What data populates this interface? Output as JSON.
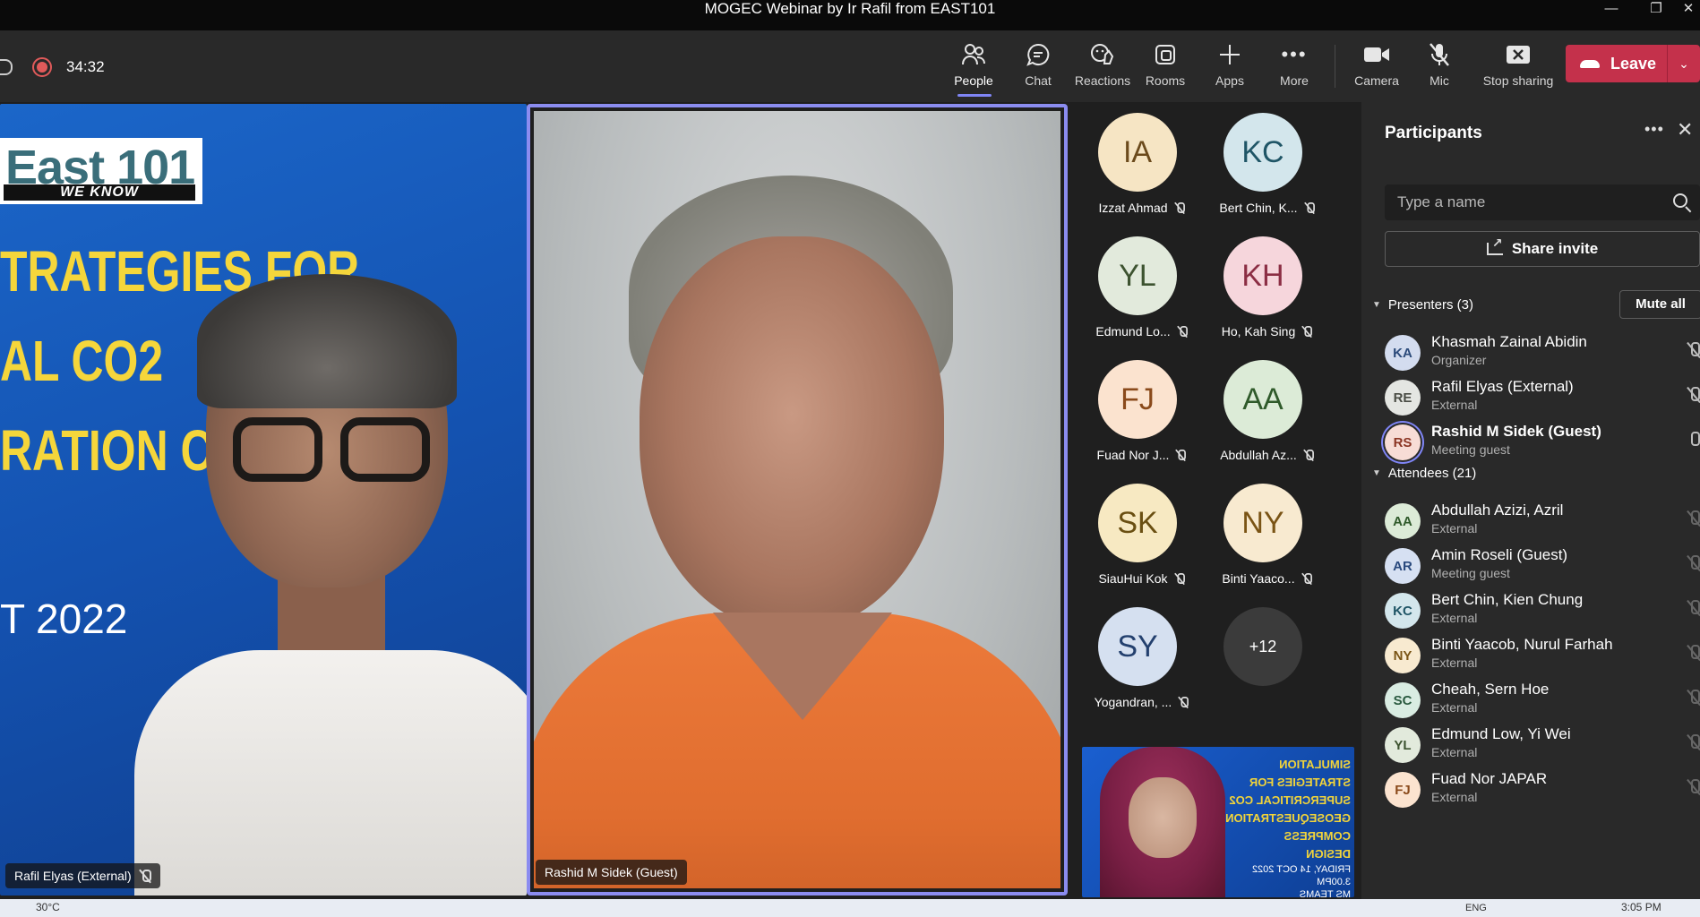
{
  "window": {
    "title": "MOGEC Webinar by Ir Rafil from EAST101"
  },
  "call": {
    "elapsed": "34:32"
  },
  "toolbar": {
    "people": "People",
    "chat": "Chat",
    "reactions": "Reactions",
    "rooms": "Rooms",
    "apps": "Apps",
    "more": "More",
    "camera": "Camera",
    "mic": "Mic",
    "stop_sharing": "Stop sharing",
    "leave": "Leave"
  },
  "stage": {
    "tile1": {
      "logo_main": "East 101",
      "logo_sub": "WE KNOW",
      "slide_lines": [
        "TRATEGIES FOR",
        "AL CO2",
        "RATION C"
      ],
      "slide_date": "T 2022",
      "name": "Rafil Elyas (External)"
    },
    "tile2": {
      "name": "Rashid M Sidek (Guest)"
    },
    "gallery": [
      {
        "initials": "IA",
        "name": "Izzat Ahmad",
        "bg": "#f6e5c4",
        "fg": "#6b4a1c"
      },
      {
        "initials": "KC",
        "name": "Bert Chin, K...",
        "bg": "#d3e6ec",
        "fg": "#1f5566"
      },
      {
        "initials": "YL",
        "name": "Edmund Lo...",
        "bg": "#e2eadc",
        "fg": "#3d5330"
      },
      {
        "initials": "KH",
        "name": "Ho, Kah Sing",
        "bg": "#f6d6dc",
        "fg": "#8b2e44"
      },
      {
        "initials": "FJ",
        "name": "Fuad Nor J...",
        "bg": "#fbe3cf",
        "fg": "#8a4a1b"
      },
      {
        "initials": "AA",
        "name": "Abdullah Az...",
        "bg": "#dcebd7",
        "fg": "#2f5a2a"
      },
      {
        "initials": "SK",
        "name": "SiauHui Kok",
        "bg": "#f7e9c2",
        "fg": "#6a4f12"
      },
      {
        "initials": "NY",
        "name": "Binti Yaaco...",
        "bg": "#f8ead0",
        "fg": "#7a5415"
      },
      {
        "initials": "SY",
        "name": "Yogandran, ...",
        "bg": "#d5e0f0",
        "fg": "#23406e"
      }
    ],
    "overflow_count": "+12",
    "tile3": {
      "slide_lines": [
        "SIMULATION STRATEGIES FOR",
        "SUPERCRITICAL CO2",
        "GEOSEQUESTRATION COMPRESS",
        "DESIGN"
      ],
      "slide_small": [
        "FRIDAY, 14 OCT 2022",
        "3.00PM",
        "MS TEAMS"
      ]
    }
  },
  "panel": {
    "title": "Participants",
    "search_placeholder": "Type a name",
    "share_invite": "Share invite",
    "presenters_label": "Presenters (3)",
    "mute_all": "Mute all",
    "presenters": [
      {
        "initials": "KA",
        "name": "Khasmah Zainal Abidin",
        "role": "Organizer",
        "bg": "#d3dcef",
        "fg": "#2b4a7a"
      },
      {
        "initials": "RE",
        "name": "Rafil Elyas (External)",
        "role": "External",
        "bg": "#e4e6e2",
        "fg": "#4a4d45"
      },
      {
        "initials": "RS",
        "name": "Rashid M Sidek (Guest)",
        "role": "Meeting guest",
        "bg": "#f7dcd6",
        "fg": "#8b3524"
      }
    ],
    "attendees_label": "Attendees (21)",
    "attendees": [
      {
        "initials": "AA",
        "name": "Abdullah Azizi, Azril",
        "role": "External",
        "bg": "#dcebd7",
        "fg": "#2f5a2a"
      },
      {
        "initials": "AR",
        "name": "Amin Roseli (Guest)",
        "role": "Meeting guest",
        "bg": "#d6e0f2",
        "fg": "#2a4a7e"
      },
      {
        "initials": "KC",
        "name": "Bert Chin, Kien Chung",
        "role": "External",
        "bg": "#d3e6ec",
        "fg": "#1f5566"
      },
      {
        "initials": "NY",
        "name": "Binti Yaacob, Nurul Farhah",
        "role": "External",
        "bg": "#f8ead0",
        "fg": "#7a5415"
      },
      {
        "initials": "SC",
        "name": "Cheah, Sern Hoe",
        "role": "External",
        "bg": "#d9ece2",
        "fg": "#2a5a40"
      },
      {
        "initials": "YL",
        "name": "Edmund Low, Yi Wei",
        "role": "External",
        "bg": "#e2eadc",
        "fg": "#3d5330"
      },
      {
        "initials": "FJ",
        "name": "Fuad Nor JAPAR",
        "role": "External",
        "bg": "#fbe3cf",
        "fg": "#8a4a1b"
      }
    ]
  },
  "taskbar": {
    "temp": "30°C",
    "lang": "ENG",
    "clock": "3:05 PM"
  }
}
